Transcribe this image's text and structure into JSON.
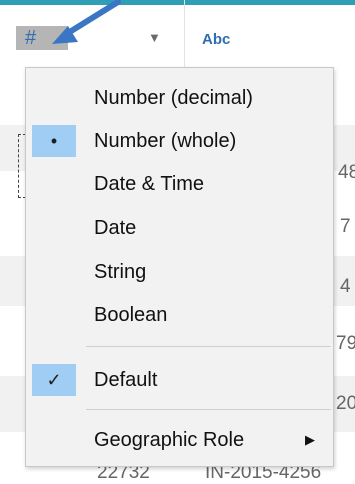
{
  "header": {
    "type_icon": "#",
    "type_dropdown_icon": "chevron-down-icon",
    "second_column_type": "Abc"
  },
  "background_rows": [
    {
      "right_fragment": "48"
    },
    {
      "right_fragment": "7"
    },
    {
      "right_fragment": "4"
    },
    {
      "right_fragment": "79"
    },
    {
      "right_fragment": "20"
    },
    {
      "left_value": "22732",
      "right_value": "IN-2015-4256"
    }
  ],
  "menu": {
    "items": [
      {
        "label": "Number (decimal)",
        "selected": false
      },
      {
        "label": "Number (whole)",
        "selected": true,
        "marker": "•"
      },
      {
        "label": "Date & Time",
        "selected": false
      },
      {
        "label": "Date",
        "selected": false
      },
      {
        "label": "String",
        "selected": false
      },
      {
        "label": "Boolean",
        "selected": false
      }
    ],
    "default_item": {
      "label": "Default",
      "checked": true,
      "marker": "✓"
    },
    "geographic_item": {
      "label": "Geographic Role",
      "submenu_icon": "▶"
    }
  },
  "colors": {
    "accent": "#2f9fb6",
    "selection": "#9fcdf3",
    "type_icon": "#2d6fb0",
    "pointer_arrow": "#3a76c4"
  }
}
